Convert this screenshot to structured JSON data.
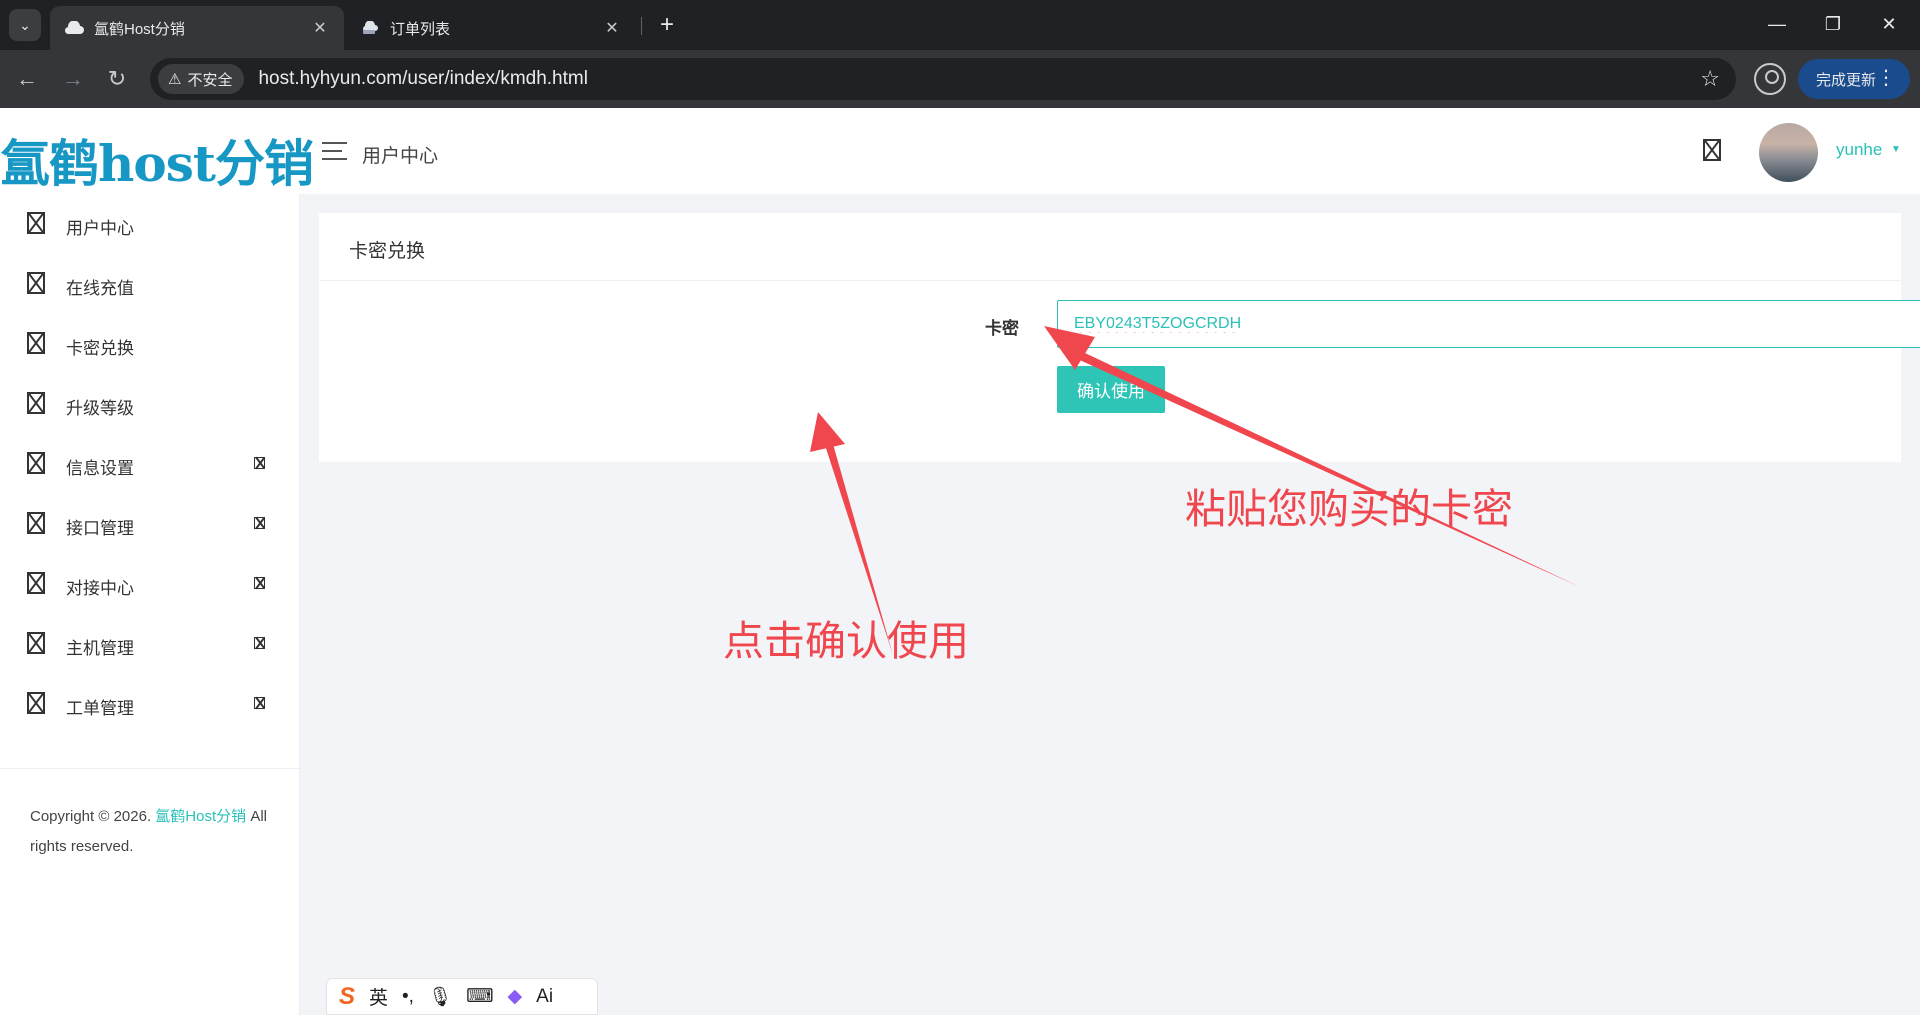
{
  "browser": {
    "tabs": [
      {
        "title": "氲鹤Host分销",
        "active": true,
        "icon": "cloud-icon"
      },
      {
        "title": "订单列表",
        "active": false,
        "icon": "cloud-car-icon"
      }
    ],
    "security_label": "不安全",
    "url": "host.hyhyun.com/user/index/kmdh.html",
    "update_label": "完成更新"
  },
  "header": {
    "logo_text": "氲鹤host分销",
    "title": "用户中心",
    "user_name": "yunhe"
  },
  "sidebar": {
    "items": [
      {
        "label": "用户中心",
        "has_submenu": false
      },
      {
        "label": "在线充值",
        "has_submenu": false
      },
      {
        "label": "卡密兑换",
        "has_submenu": false
      },
      {
        "label": "升级等级",
        "has_submenu": false
      },
      {
        "label": "信息设置",
        "has_submenu": true
      },
      {
        "label": "接口管理",
        "has_submenu": true
      },
      {
        "label": "对接中心",
        "has_submenu": true
      },
      {
        "label": "主机管理",
        "has_submenu": true
      },
      {
        "label": "工单管理",
        "has_submenu": true
      }
    ],
    "copyright_prefix": "Copyright © 2026.",
    "copyright_brand": "氲鹤Host分销",
    "copyright_suffix": "All rights reserved."
  },
  "main": {
    "card_title": "卡密兑换",
    "form_label": "卡密",
    "code_value": "EBY0243T5ZOGCRDH",
    "submit_label": "确认使用"
  },
  "annotations": {
    "paste_hint": "粘贴您购买的卡密",
    "click_hint": "点击确认使用",
    "color": "#f0474e"
  },
  "ime": {
    "lang_label": "英",
    "ai_label": "Ai"
  },
  "colors": {
    "accent": "#2bc0b8",
    "logo": "#1797c4",
    "browser_dark": "#202124"
  }
}
